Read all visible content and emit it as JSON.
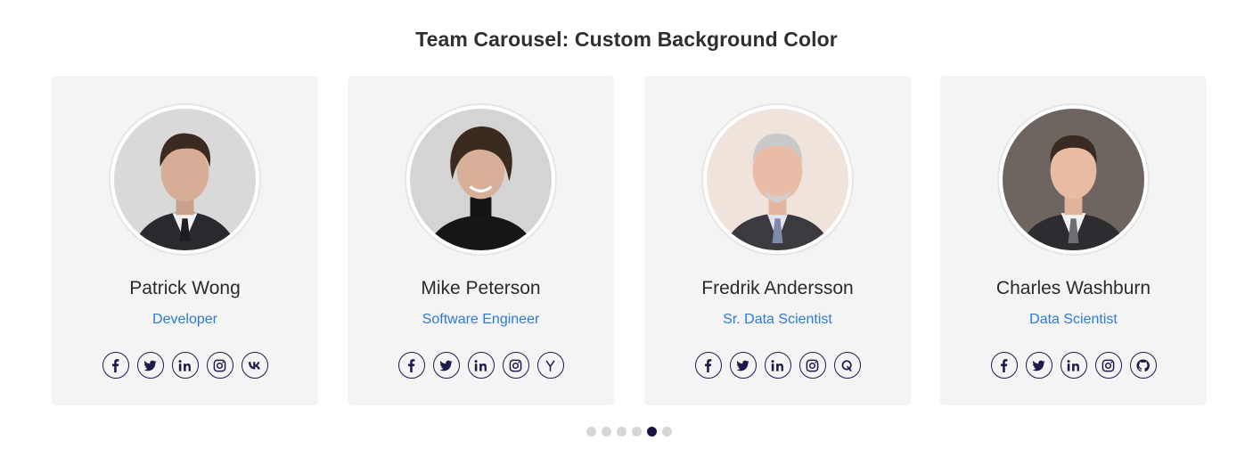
{
  "title": "Team Carousel: Custom Background Color",
  "colors": {
    "card_bg": "#f4f4f4",
    "role": "#2f7ad6",
    "icon": "#1c1a4a",
    "dot": "#d6d6d6",
    "dot_active": "#191542"
  },
  "members": [
    {
      "name": "Patrick Wong",
      "role": "Developer",
      "socials": [
        "facebook-icon",
        "twitter-icon",
        "linkedin-icon",
        "instagram-icon",
        "vk-icon"
      ]
    },
    {
      "name": "Mike Peterson",
      "role": "Software Engineer",
      "socials": [
        "facebook-icon",
        "twitter-icon",
        "linkedin-icon",
        "instagram-icon",
        "ycombinator-icon"
      ]
    },
    {
      "name": "Fredrik Andersson",
      "role": "Sr. Data Scientist",
      "socials": [
        "facebook-icon",
        "twitter-icon",
        "linkedin-icon",
        "instagram-icon",
        "quora-icon"
      ]
    },
    {
      "name": "Charles Washburn",
      "role": "Data Scientist",
      "socials": [
        "facebook-icon",
        "twitter-icon",
        "linkedin-icon",
        "instagram-icon",
        "github-icon"
      ]
    }
  ],
  "pagination": {
    "count": 6,
    "active_index": 4
  }
}
